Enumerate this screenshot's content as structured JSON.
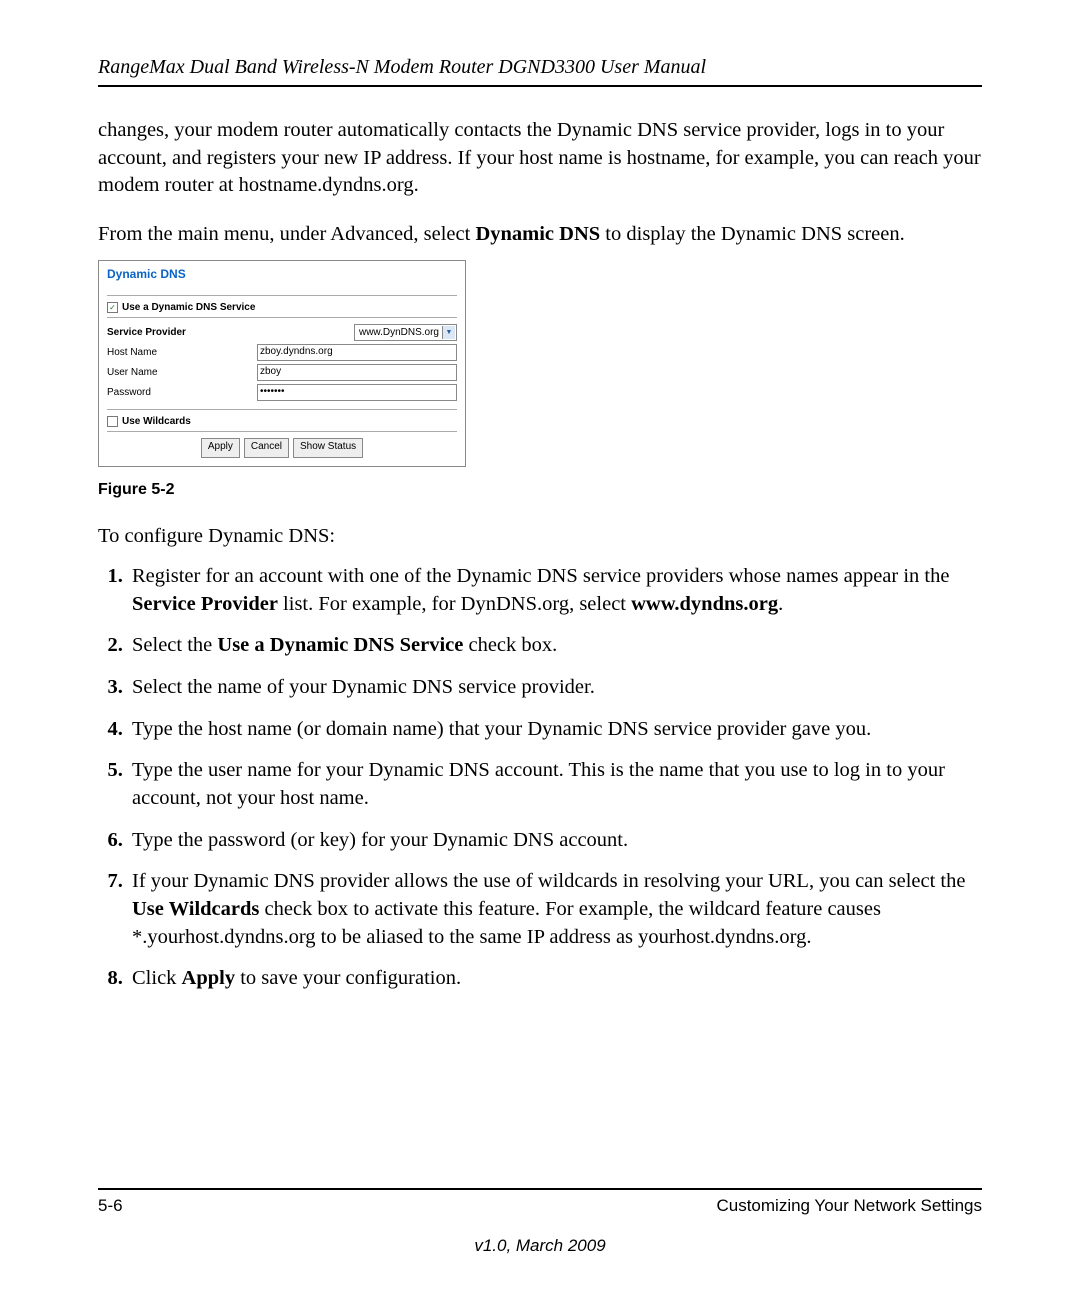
{
  "header": {
    "title": "RangeMax Dual Band Wireless-N Modem Router DGND3300 User Manual"
  },
  "body": {
    "p1": "changes, your modem router automatically contacts the Dynamic DNS service provider, logs in to your account, and registers your new IP address. If your host name is hostname, for example, you can reach your modem router at hostname.dyndns.org.",
    "p2_pre": "From the main menu, under Advanced, select ",
    "p2_bold": "Dynamic DNS",
    "p2_post": " to display the Dynamic DNS screen.",
    "figure_caption": "Figure 5-2",
    "config_intro": "To configure Dynamic DNS:"
  },
  "screenshot": {
    "title": "Dynamic DNS",
    "use_service_label": "Use a Dynamic DNS Service",
    "use_service_checked": true,
    "service_provider_label": "Service Provider",
    "service_provider_value": "www.DynDNS.org",
    "host_name_label": "Host Name",
    "host_name_value": "zboy.dyndns.org",
    "user_name_label": "User Name",
    "user_name_value": "zboy",
    "password_label": "Password",
    "password_value": "•••••••",
    "use_wildcards_label": "Use Wildcards",
    "use_wildcards_checked": false,
    "btn_apply": "Apply",
    "btn_cancel": "Cancel",
    "btn_show_status": "Show Status"
  },
  "steps": {
    "s1_pre": "Register for an account with one of the Dynamic DNS service providers whose names appear in the ",
    "s1_b1": "Service Provider",
    "s1_mid": " list. For example, for DynDNS.org, select ",
    "s1_b2": "www.dyndns.org",
    "s1_post": ".",
    "s2_pre": "Select the ",
    "s2_b": "Use a Dynamic DNS Service",
    "s2_post": " check box.",
    "s3": "Select the name of your Dynamic DNS service provider.",
    "s4": "Type the host name (or domain name) that your Dynamic DNS service provider gave you.",
    "s5": "Type the user name for your Dynamic DNS account. This is the name that you use to log in to your account, not your host name.",
    "s6": "Type the password (or key) for your Dynamic DNS account.",
    "s7_pre": "If your Dynamic DNS provider allows the use of wildcards in resolving your URL, you can select the ",
    "s7_b": "Use Wildcards",
    "s7_post": " check box to activate this feature. For example, the wildcard feature causes *.yourhost.dyndns.org to be aliased to the same IP address as yourhost.dyndns.org.",
    "s8_pre": "Click ",
    "s8_b": "Apply",
    "s8_post": " to save your configuration."
  },
  "footer": {
    "page": "5-6",
    "section": "Customizing Your Network Settings",
    "version": "v1.0, March 2009"
  }
}
